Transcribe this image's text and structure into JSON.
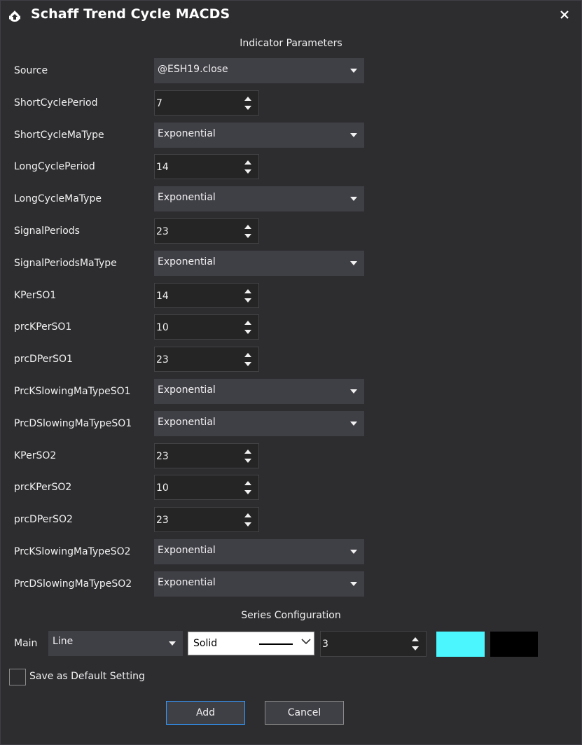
{
  "window": {
    "title": "Schaff Trend Cycle MACDS",
    "icon": "indicator-app-icon",
    "close_glyph": "✕"
  },
  "sections": {
    "indicator_parameters": "Indicator Parameters",
    "series_configuration": "Series Configuration"
  },
  "params": [
    {
      "label": "Source",
      "kind": "dropdown",
      "value": "@ESH19.close"
    },
    {
      "label": "ShortCyclePeriod",
      "kind": "spinner",
      "value": "7"
    },
    {
      "label": "ShortCycleMaType",
      "kind": "dropdown",
      "value": "Exponential"
    },
    {
      "label": "LongCyclePeriod",
      "kind": "spinner",
      "value": "14"
    },
    {
      "label": "LongCycleMaType",
      "kind": "dropdown",
      "value": "Exponential"
    },
    {
      "label": "SignalPeriods",
      "kind": "spinner",
      "value": "23"
    },
    {
      "label": "SignalPeriodsMaType",
      "kind": "dropdown",
      "value": "Exponential"
    },
    {
      "label": "KPerSO1",
      "kind": "spinner",
      "value": "14"
    },
    {
      "label": "prcKPerSO1",
      "kind": "spinner",
      "value": "10"
    },
    {
      "label": "prcDPerSO1",
      "kind": "spinner",
      "value": "23"
    },
    {
      "label": "PrcKSlowingMaTypeSO1",
      "kind": "dropdown",
      "value": "Exponential"
    },
    {
      "label": "PrcDSlowingMaTypeSO1",
      "kind": "dropdown",
      "value": "Exponential"
    },
    {
      "label": "KPerSO2",
      "kind": "spinner",
      "value": "23"
    },
    {
      "label": "prcKPerSO2",
      "kind": "spinner",
      "value": "10"
    },
    {
      "label": "prcDPerSO2",
      "kind": "spinner",
      "value": "23"
    },
    {
      "label": "PrcKSlowingMaTypeSO2",
      "kind": "dropdown",
      "value": "Exponential"
    },
    {
      "label": "PrcDSlowingMaTypeSO2",
      "kind": "dropdown",
      "value": "Exponential"
    }
  ],
  "series": {
    "name": "Main",
    "type": "Line",
    "line_style": "Solid",
    "width": "3",
    "color_primary": "#4cf6ff",
    "color_secondary": "#000000"
  },
  "save_default_label": "Save as Default Setting",
  "save_default_checked": false,
  "buttons": {
    "add": "Add",
    "cancel": "Cancel"
  },
  "colors": {
    "background": "#2d2d30",
    "control": "#3f3f46",
    "accent": "#3399ff"
  }
}
